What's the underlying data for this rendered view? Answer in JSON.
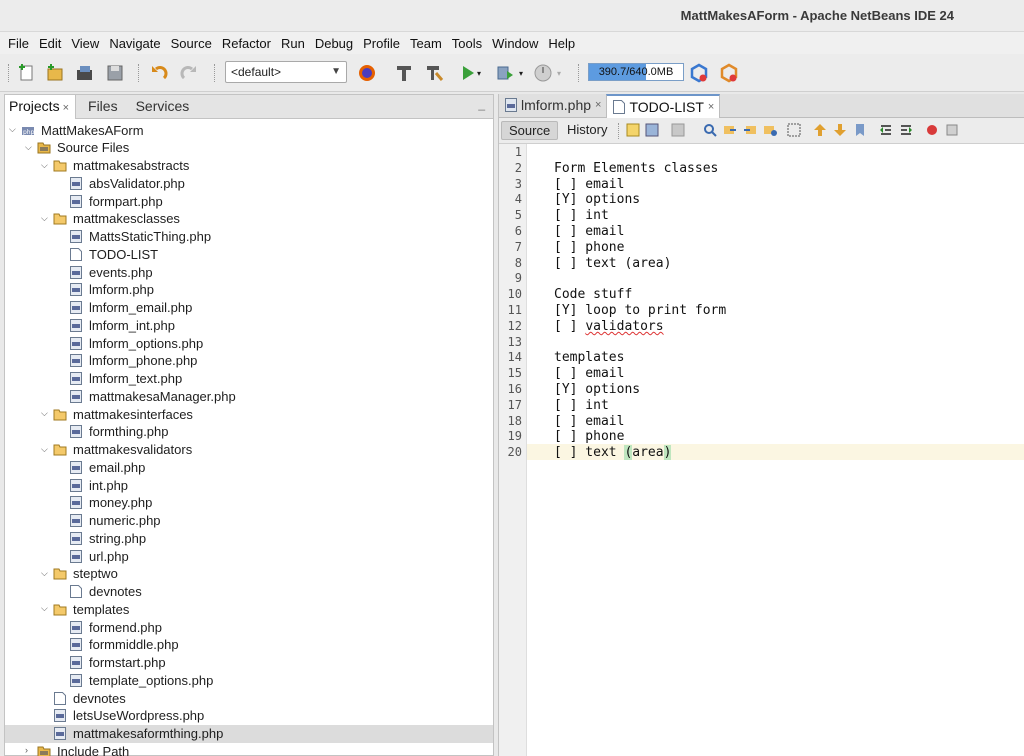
{
  "window": {
    "title": "MattMakesAForm - Apache NetBeans IDE 24"
  },
  "menu": [
    "File",
    "Edit",
    "View",
    "Navigate",
    "Source",
    "Refactor",
    "Run",
    "Debug",
    "Profile",
    "Team",
    "Tools",
    "Window",
    "Help"
  ],
  "toolbar": {
    "config_combo": "<default>",
    "memory": "390.7/640.0MB",
    "memory_fraction": 0.61
  },
  "left_panel": {
    "tabs": [
      "Projects",
      "Files",
      "Services"
    ],
    "close_glyph": "×",
    "minimize_glyph": "_",
    "tree": [
      {
        "label": "MattMakesAForm",
        "icon": "project-icon",
        "toggle": "expanded"
      },
      {
        "label": "Source Files",
        "icon": "package-icon",
        "toggle": "expanded"
      },
      {
        "label": "mattmakesabstracts",
        "icon": "folder-icon",
        "toggle": "expanded"
      },
      {
        "label": "absValidator.php",
        "icon": "php-file-icon"
      },
      {
        "label": "formpart.php",
        "icon": "php-file-icon"
      },
      {
        "label": "mattmakesclasses",
        "icon": "folder-icon",
        "toggle": "expanded"
      },
      {
        "label": "MattsStaticThing.php",
        "icon": "php-file-icon"
      },
      {
        "label": "TODO-LIST",
        "icon": "text-file-icon"
      },
      {
        "label": "events.php",
        "icon": "php-file-icon"
      },
      {
        "label": "lmform.php",
        "icon": "php-file-icon"
      },
      {
        "label": "lmform_email.php",
        "icon": "php-file-icon"
      },
      {
        "label": "lmform_int.php",
        "icon": "php-file-icon"
      },
      {
        "label": "lmform_options.php",
        "icon": "php-file-icon"
      },
      {
        "label": "lmform_phone.php",
        "icon": "php-file-icon"
      },
      {
        "label": "lmform_text.php",
        "icon": "php-file-icon"
      },
      {
        "label": "mattmakesaManager.php",
        "icon": "php-file-icon"
      },
      {
        "label": "mattmakesinterfaces",
        "icon": "folder-icon",
        "toggle": "expanded"
      },
      {
        "label": "formthing.php",
        "icon": "php-file-icon"
      },
      {
        "label": "mattmakesvalidators",
        "icon": "folder-icon",
        "toggle": "expanded"
      },
      {
        "label": "email.php",
        "icon": "php-file-icon"
      },
      {
        "label": "int.php",
        "icon": "php-file-icon"
      },
      {
        "label": "money.php",
        "icon": "php-file-icon"
      },
      {
        "label": "numeric.php",
        "icon": "php-file-icon"
      },
      {
        "label": "string.php",
        "icon": "php-file-icon"
      },
      {
        "label": "url.php",
        "icon": "php-file-icon"
      },
      {
        "label": "steptwo",
        "icon": "folder-icon",
        "toggle": "expanded"
      },
      {
        "label": "devnotes",
        "icon": "text-file-icon"
      },
      {
        "label": "templates",
        "icon": "folder-icon",
        "toggle": "expanded"
      },
      {
        "label": "formend.php",
        "icon": "php-file-icon"
      },
      {
        "label": "formmiddle.php",
        "icon": "php-file-icon"
      },
      {
        "label": "formstart.php",
        "icon": "php-file-icon"
      },
      {
        "label": "template_options.php",
        "icon": "php-file-icon"
      },
      {
        "label": "devnotes",
        "icon": "text-file-icon"
      },
      {
        "label": "letsUseWordpress.php",
        "icon": "php-file-icon"
      },
      {
        "label": "mattmakesaformthing.php",
        "icon": "php-file-icon",
        "selected": true
      },
      {
        "label": "Include Path",
        "icon": "package-icon",
        "toggle": "collapsed"
      }
    ]
  },
  "editor": {
    "tabs": [
      "lmform.php",
      "TODO-LIST"
    ],
    "active_tab": "TODO-LIST",
    "modes": [
      "Source",
      "History"
    ],
    "lines": [
      "",
      "Form Elements classes",
      "[ ] email",
      "[Y] options",
      "[ ] int",
      "[ ] email",
      "[ ] phone",
      "[ ] text (area)",
      "",
      "Code stuff",
      "[Y] loop to print form",
      "[ ] validators",
      "",
      "templates",
      "[ ] email",
      "[Y] options",
      "[ ] int",
      "[ ] email",
      "[ ] phone",
      "[ ] text (area)"
    ],
    "current_line": 20
  }
}
